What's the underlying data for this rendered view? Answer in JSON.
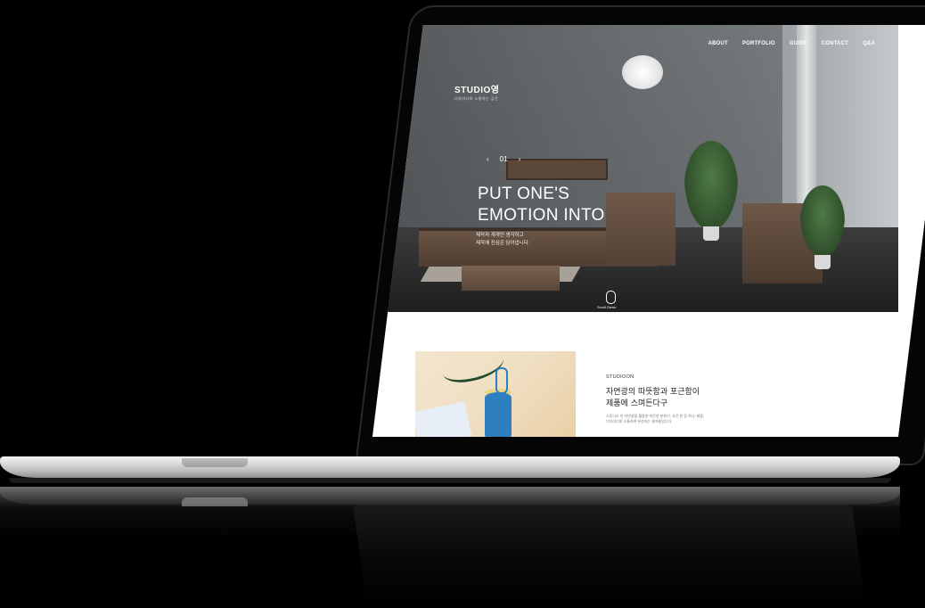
{
  "site": {
    "logo": "STUDIO영",
    "logo_sub": "디자이너와 소통하는 공간"
  },
  "nav": {
    "items": [
      "ABOUT",
      "PORTFOLIO",
      "GUIDE",
      "CONTACT",
      "Q&A"
    ]
  },
  "hero": {
    "slide_index": "01",
    "prev": "‹",
    "next": "›",
    "headline_line1": "PUT ONE'S",
    "headline_line2": "EMOTION INTO",
    "subtext_line1": "제작자 개개인 생각하고",
    "subtext_line2": "제작에 진심은 담아냅니다.",
    "scroll_label": "Scroll Down"
  },
  "about": {
    "tag": "STUDIOON",
    "title_line1": "자연광의 따뜻함과 포근함이",
    "title_line2": "제품에 스며든다구",
    "body_line1": "스튜디오 안 자연광을 활용한 따뜻한 분위기, 사진 한 장 하나, 제품,",
    "body_line2": "디자이너와 소통하며 완성하는 결과물입니다."
  },
  "colors": {
    "hero_overlay_text": "#ffffff",
    "page_bg": "#ffffff",
    "device_frame": "#050505",
    "accent_blue": "#2d7fbf"
  }
}
